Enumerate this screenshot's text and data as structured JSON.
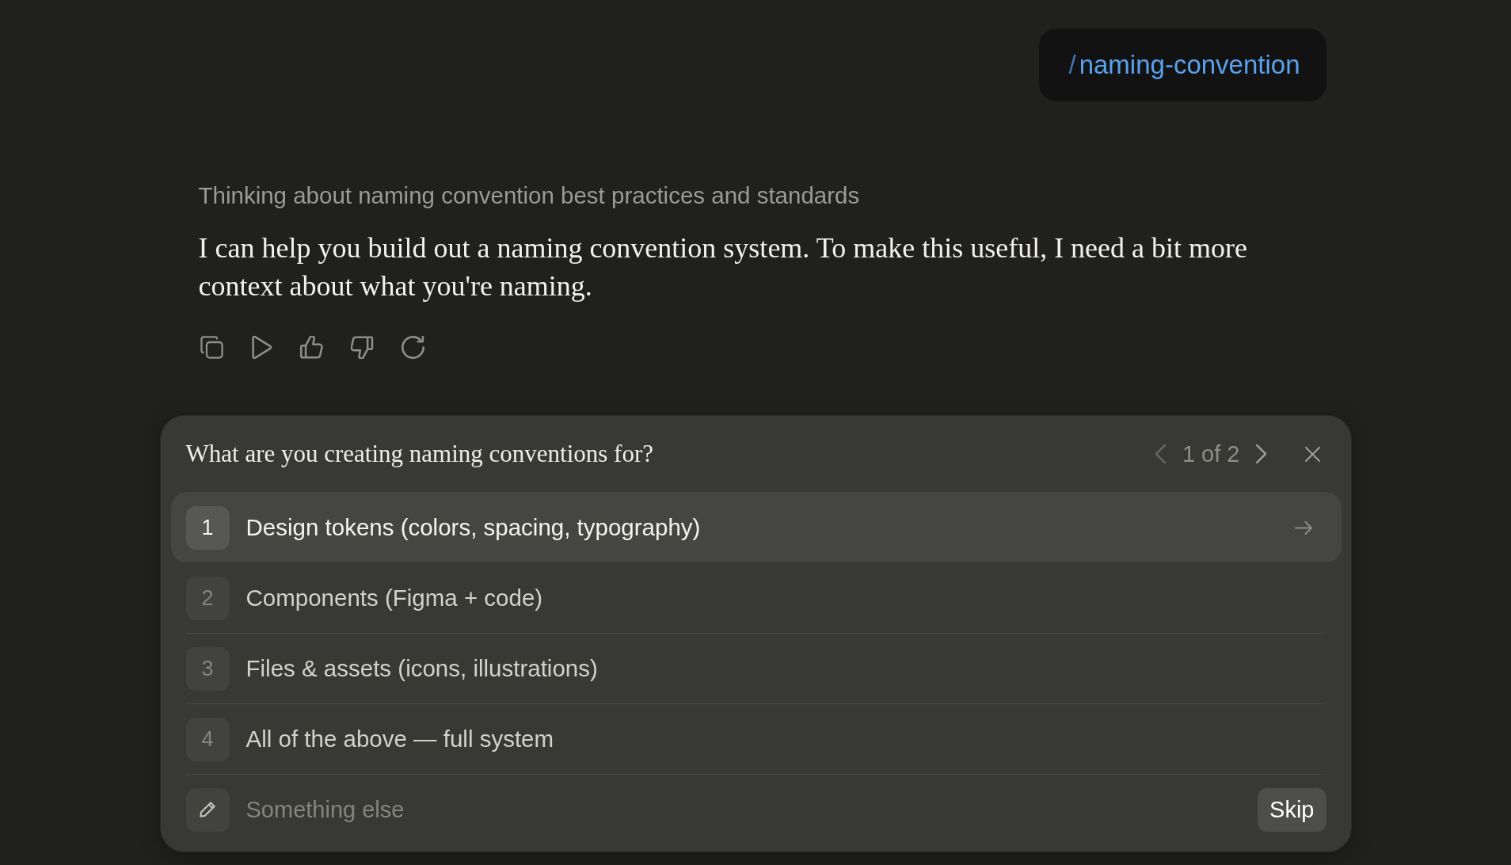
{
  "user_message": {
    "slash": "/",
    "command": "naming-convention"
  },
  "assistant": {
    "thinking_summary": "Thinking about naming convention best practices and standards",
    "reply": "I can help you build out a naming convention system. To make this useful, I need a bit more context about what you're naming."
  },
  "question_card": {
    "question": "What are you creating naming conventions for?",
    "pager": {
      "label": "1 of 2",
      "prev_disabled": true,
      "next_disabled": false
    },
    "options": [
      {
        "number": "1",
        "label": "Design tokens (colors, spacing, typography)",
        "selected": true
      },
      {
        "number": "2",
        "label": "Components (Figma + code)",
        "selected": false
      },
      {
        "number": "3",
        "label": "Files & assets (icons, illustrations)",
        "selected": false
      },
      {
        "number": "4",
        "label": "All of the above — full system",
        "selected": false
      }
    ],
    "other_answer": {
      "placeholder": "Something else"
    },
    "skip_button": "Skip"
  }
}
